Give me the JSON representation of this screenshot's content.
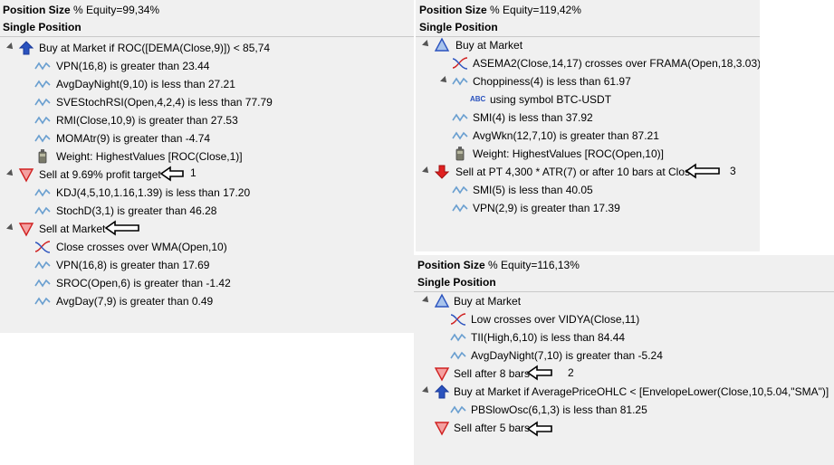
{
  "panels": [
    {
      "header_label": "Position Size",
      "header_value": "% Equity=99,34%",
      "sub": "Single Position",
      "rows": [
        {
          "text": "Buy at Market if ROC([DEMA(Close,9)]) < 85,74",
          "icon": "buy-arrow-icon"
        },
        {
          "text": "VPN(16,8) is greater than 23.44",
          "icon": "indicator-wave-icon"
        },
        {
          "text": "AvgDayNight(9,10) is less than 27.21",
          "icon": "indicator-wave-icon"
        },
        {
          "text": "SVEStochRSI(Open,4,2,4) is less than 77.79",
          "icon": "indicator-wave-icon"
        },
        {
          "text": "RMI(Close,10,9) is greater than 27.53",
          "icon": "indicator-wave-icon"
        },
        {
          "text": "MOMAtr(9) is greater than -4.74",
          "icon": "indicator-wave-icon"
        },
        {
          "text": "Weight: HighestValues [ROC(Close,1)]",
          "icon": "weight-icon"
        },
        {
          "text": "Sell at 9.69% profit target",
          "icon": "sell-triangle-icon",
          "annotation": "1"
        },
        {
          "text": "KDJ(4,5,10,1.16,1.39) is less than 17.20",
          "icon": "indicator-wave-icon"
        },
        {
          "text": "StochD(3,1) is greater than 46.28",
          "icon": "indicator-wave-icon"
        },
        {
          "text": "Sell at Market",
          "icon": "sell-triangle-icon"
        },
        {
          "text": "Close crosses over WMA(Open,10)",
          "icon": "crossover-icon"
        },
        {
          "text": "VPN(16,8) is greater than 17.69",
          "icon": "indicator-wave-icon"
        },
        {
          "text": "SROC(Open,6) is greater than -1.42",
          "icon": "indicator-wave-icon"
        },
        {
          "text": "AvgDay(7,9) is greater than 0.49",
          "icon": "indicator-wave-icon"
        }
      ]
    },
    {
      "header_label": "Position Size",
      "header_value": "% Equity=119,42%",
      "sub": "Single Position",
      "rows": [
        {
          "text": "Buy at Market",
          "icon": "buy-triangle-icon"
        },
        {
          "text": "ASEMA2(Close,14,17) crosses over FRAMA(Open,18,3.03)",
          "icon": "crossover-icon"
        },
        {
          "text": "Choppiness(4) is less than 61.97",
          "icon": "indicator-wave-icon"
        },
        {
          "text": "using symbol BTC-USDT",
          "icon": "abc-icon"
        },
        {
          "text": "SMI(4) is less than 37.92",
          "icon": "indicator-wave-icon"
        },
        {
          "text": "AvgWkn(12,7,10) is greater than 87.21",
          "icon": "indicator-wave-icon"
        },
        {
          "text": "Weight: HighestValues [ROC(Open,10)]",
          "icon": "weight-icon"
        },
        {
          "text": "Sell at PT 4,300 * ATR(7) or after 10 bars at Close",
          "icon": "sell-arrow-icon",
          "annotation": "3"
        },
        {
          "text": "SMI(5) is less than 40.05",
          "icon": "indicator-wave-icon"
        },
        {
          "text": "VPN(2,9) is greater than 17.39",
          "icon": "indicator-wave-icon"
        }
      ]
    },
    {
      "header_label": "Position Size",
      "header_value": "% Equity=116,13%",
      "sub": "Single Position",
      "rows": [
        {
          "text": "Buy at Market",
          "icon": "buy-triangle-icon"
        },
        {
          "text": "Low crosses over VIDYA(Close,11)",
          "icon": "crossover-icon"
        },
        {
          "text": "TII(High,6,10) is less than 84.44",
          "icon": "indicator-wave-icon"
        },
        {
          "text": "AvgDayNight(7,10) is greater than -5.24",
          "icon": "indicator-wave-icon"
        },
        {
          "text": "Sell after 8 bars",
          "icon": "sell-triangle-icon",
          "annotation": "2"
        },
        {
          "text": "Buy at Market if AveragePriceOHLC < [EnvelopeLower(Close,10,5.04,\"SMA\")]",
          "icon": "buy-arrow-icon"
        },
        {
          "text": "PBSlowOsc(6,1,3) is less than 81.25",
          "icon": "indicator-wave-icon"
        },
        {
          "text": "Sell after 5 bars",
          "icon": "sell-triangle-icon"
        }
      ]
    }
  ]
}
